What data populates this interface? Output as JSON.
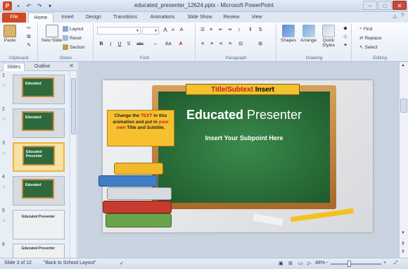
{
  "window": {
    "title": "educated_presenter_12624.pptx - Microsoft PowerPoint",
    "app_icon_label": "P"
  },
  "qat": {
    "save_icon": "save-icon",
    "undo_icon": "undo-icon",
    "redo_icon": "redo-icon"
  },
  "tabs": {
    "file": "File",
    "items": [
      "Home",
      "Insert",
      "Design",
      "Transitions",
      "Animations",
      "Slide Show",
      "Review",
      "View"
    ],
    "active": "Home"
  },
  "ribbon": {
    "clipboard": {
      "label": "Clipboard",
      "paste": "Paste"
    },
    "slides": {
      "label": "Slides",
      "new_slide": "New Slide",
      "layout": "Layout",
      "reset": "Reset",
      "section": "Section"
    },
    "font": {
      "label": "Font",
      "bold": "B",
      "italic": "I",
      "underline": "U",
      "strike": "S",
      "shadow": "abc",
      "grow": "A",
      "shrink": "A",
      "case": "Aa",
      "clear": "A"
    },
    "paragraph": {
      "label": "Paragraph"
    },
    "drawing": {
      "label": "Drawing",
      "shapes": "Shapes",
      "arrange": "Arrange",
      "quick_styles": "Quick Styles"
    },
    "editing": {
      "label": "Editing",
      "find": "Find",
      "replace": "Replace",
      "select": "Select"
    }
  },
  "pane": {
    "tabs": [
      "Slides",
      "Outline"
    ],
    "active": "Slides",
    "thumbnails": [
      {
        "num": "1",
        "text": "Educated"
      },
      {
        "num": "2",
        "text": "Educated"
      },
      {
        "num": "3",
        "text": "Educated Presenter"
      },
      {
        "num": "4",
        "text": "Educated"
      },
      {
        "num": "5",
        "text": "Educated Presenter"
      },
      {
        "num": "6",
        "text": "Educated Presenter"
      }
    ],
    "selected": "3"
  },
  "slide": {
    "banner_part1": "Title/Subtext",
    "banner_part2": "Insert",
    "headline_bold": "Educated",
    "headline_rest": "Presenter",
    "subline": "Insert Your Subpoint Here",
    "callout": {
      "t1": "Change the ",
      "t2": "TEXT",
      "t3": " in this animation and put in ",
      "t4": "your own",
      "t5": " Title and Subtitle."
    }
  },
  "status": {
    "slide": "Slide 3 of 12",
    "layout": "\"Back to School Layout\"",
    "zoom": "48%"
  },
  "colors": {
    "file_tab": "#d24726",
    "board": "#2d6a3e",
    "banner": "#f2c12e",
    "callout": "#f6c02f"
  }
}
